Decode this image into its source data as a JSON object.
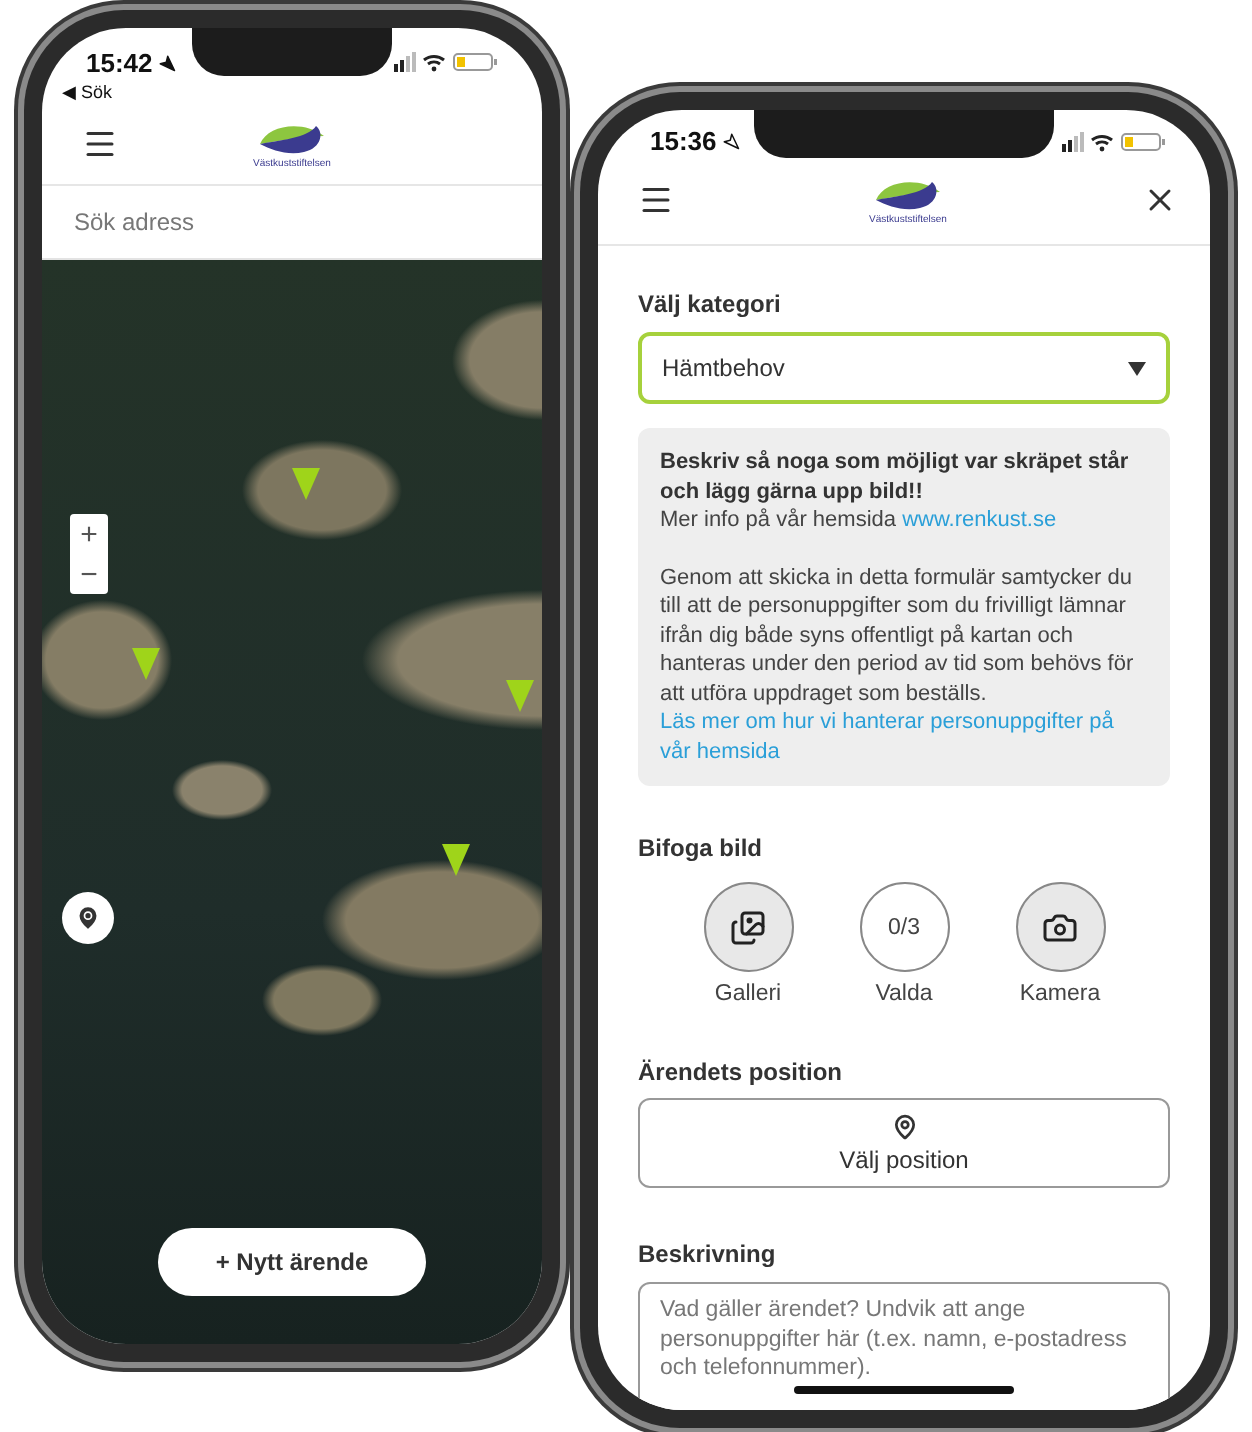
{
  "map_phone": {
    "status_bar": {
      "time": "15:42",
      "back_link": "◀ Sök"
    },
    "logo_text": "Västkuststiftelsen",
    "search": {
      "placeholder": "Sök adress"
    },
    "map": {
      "zoom_in": "+",
      "zoom_out": "−"
    },
    "new_case_button": "+ Nytt ärende"
  },
  "form_phone": {
    "status_bar": {
      "time": "15:36"
    },
    "logo_text": "Västkuststiftelsen",
    "category": {
      "label": "Välj kategori",
      "value": "Hämtbehov"
    },
    "info": {
      "heading": "Beskriv så noga som möjligt var skräpet står och lägg gärna upp bild!!",
      "more_info": "Mer info på vår hemsida",
      "link": "www.renkust.se",
      "consent": "Genom att skicka in detta formulär samtycker du till att de personuppgifter som du frivilligt lämnar ifrån dig både syns offentligt på kartan och hanteras under den period av tid som behövs för att utföra uppdraget som beställs.",
      "privacy_link": "Läs mer om hur vi hanterar personuppgifter på vår hemsida"
    },
    "attach": {
      "label": "Bifoga bild",
      "buttons": [
        {
          "kind": "gallery",
          "label": "Galleri"
        },
        {
          "kind": "count",
          "text": "0/3",
          "label": "Valda"
        },
        {
          "kind": "camera",
          "label": "Kamera"
        }
      ]
    },
    "position": {
      "label": "Ärendets position",
      "button": "Välj position"
    },
    "description": {
      "label": "Beskrivning",
      "placeholder": "Vad gäller ärendet? Undvik att ange personuppgifter här (t.ex. namn, e-postadress och telefonnummer)."
    }
  }
}
